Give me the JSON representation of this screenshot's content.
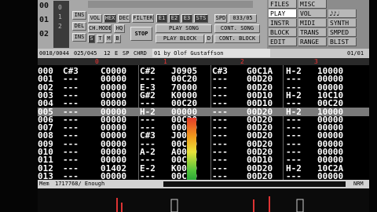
{
  "app": {
    "name": "ProTracker"
  },
  "top": {
    "position_value": "00",
    "pattern_value": "01",
    "length_value": "02",
    "sample_nums": [
      "0",
      "1",
      "2"
    ],
    "ins_label": "INS",
    "del_label": "DEL",
    "vol_label": "VOL",
    "hex_label": "HEX",
    "dec_label": "DEC",
    "filter_label": "FILTER",
    "e_buttons": [
      "E1",
      "E2",
      "E3",
      "STS"
    ],
    "spd_label": "SPD",
    "spd_value": "033/05",
    "chmode_label": "CH.MODE",
    "hq_label": "HQ",
    "sp_labels": [
      "S",
      "T",
      "M",
      "B"
    ],
    "stop_label": "STOP",
    "play_song_label": "PLAY SONG",
    "play_block_label": "PLAY BLOCK",
    "play_block_value": "D",
    "cont_song_label": "CONT. SONG",
    "cont_block_label": "CONT. BLOCK"
  },
  "tabs": [
    [
      "FILES",
      "MISC"
    ],
    [
      "PLAY",
      "VOL"
    ],
    [
      "INSTR",
      "MIDI"
    ],
    [
      "BLOCK",
      "TRANS"
    ],
    [
      "EDIT",
      "RANGE"
    ]
  ],
  "tabs_right": [
    "𝅘𝅥𝅮♪𝅘𝅥",
    "SYNTH",
    "SMPED",
    "BLIST"
  ],
  "selected_tab": "PLAY",
  "strip": {
    "pos": "0018/0044",
    "sub": "025/045",
    "a": "12",
    "flags": [
      "E",
      "SP",
      "CHRD"
    ],
    "sample_name": "01 by Olof Gustaffson",
    "block": "01/01"
  },
  "ruler_marks": [
    "0",
    "1",
    "2",
    "3"
  ],
  "rows": [
    {
      "n": "000",
      "c1": "C#3",
      "c2": "C0000",
      "c3": "C#2",
      "c4": "J0905",
      "c5": "C#3",
      "c6": "G0C1A",
      "c7": "H-2",
      "c8": "10000"
    },
    {
      "n": "001",
      "c1": "---",
      "c2": "00000",
      "c3": "---",
      "c4": "00C20",
      "c5": "---",
      "c6": "00D20",
      "c7": "---",
      "c8": "00000"
    },
    {
      "n": "002",
      "c1": "---",
      "c2": "00000",
      "c3": "E-3",
      "c4": "70000",
      "c5": "---",
      "c6": "00D20",
      "c7": "---",
      "c8": "00000"
    },
    {
      "n": "003",
      "c1": "---",
      "c2": "00000",
      "c3": "G#2",
      "c4": "K0000",
      "c5": "---",
      "c6": "00D10",
      "c7": "H-2",
      "c8": "10C10"
    },
    {
      "n": "004",
      "c1": "---",
      "c2": "00000",
      "c3": "---",
      "c4": "00C20",
      "c5": "---",
      "c6": "00D10",
      "c7": "---",
      "c8": "00C20"
    },
    {
      "n": "005",
      "c1": "---",
      "c2": "00000",
      "c3": "H-2",
      "c4": "00000",
      "c5": "---",
      "c6": "00D20",
      "c7": "H-2",
      "c8": "10000"
    },
    {
      "n": "006",
      "c1": "---",
      "c2": "00000",
      "c3": "---",
      "c4": "00C20",
      "c5": "---",
      "c6": "00D20",
      "c7": "---",
      "c8": "00000"
    },
    {
      "n": "007",
      "c1": "---",
      "c2": "00000",
      "c3": "---",
      "c4": "00000",
      "c5": "---",
      "c6": "00D20",
      "c7": "---",
      "c8": "00000"
    },
    {
      "n": "008",
      "c1": "---",
      "c2": "00000",
      "c3": "C#3",
      "c4": "J0000",
      "c5": "---",
      "c6": "00D20",
      "c7": "---",
      "c8": "00000"
    },
    {
      "n": "009",
      "c1": "---",
      "c2": "00000",
      "c3": "---",
      "c4": "00C20",
      "c5": "---",
      "c6": "00D20",
      "c7": "---",
      "c8": "00000"
    },
    {
      "n": "010",
      "c1": "---",
      "c2": "00000",
      "c3": "A-2",
      "c4": "A0000",
      "c5": "---",
      "c6": "00D20",
      "c7": "---",
      "c8": "00000"
    },
    {
      "n": "011",
      "c1": "---",
      "c2": "00000",
      "c3": "---",
      "c4": "00C20",
      "c5": "---",
      "c6": "00D10",
      "c7": "---",
      "c8": "00000"
    },
    {
      "n": "012",
      "c1": "---",
      "c2": "01402",
      "c3": "E-2",
      "c4": "K0000",
      "c5": "---",
      "c6": "00D20",
      "c7": "H-2",
      "c8": "10C2A"
    },
    {
      "n": "013",
      "c1": "---",
      "c2": "00000",
      "c3": "---",
      "c4": "00C20",
      "c5": "---",
      "c6": "00D20",
      "c7": "---",
      "c8": "00000"
    }
  ],
  "status": {
    "mem_label": "Mem",
    "mem_value": "1717768/ Enough",
    "right": "NRM"
  }
}
